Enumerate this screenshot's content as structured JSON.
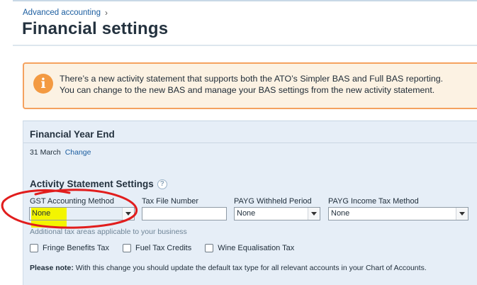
{
  "breadcrumb": {
    "parent": "Advanced accounting",
    "separator": "›"
  },
  "page": {
    "title": "Financial settings"
  },
  "notice": {
    "icon": "info-icon",
    "line1": "There’s a new activity statement that supports both the ATO’s Simpler BAS and Full BAS reporting.",
    "line2": "You can change to the new BAS and manage your BAS settings from the new activity statement."
  },
  "financial_year_end": {
    "heading": "Financial Year End",
    "value": "31 March",
    "change_link": "Change"
  },
  "activity_statement": {
    "heading": "Activity Statement Settings",
    "help_icon": "question-mark-icon",
    "fields": {
      "gst_method": {
        "label": "GST Accounting Method",
        "value": "None"
      },
      "tfn": {
        "label": "Tax File Number",
        "value": ""
      },
      "payg_withheld": {
        "label": "PAYG Withheld Period",
        "value": "None"
      },
      "payg_income": {
        "label": "PAYG Income Tax Method",
        "value": "None"
      }
    },
    "hint": "Additional tax areas applicable to your business",
    "checkboxes": {
      "fbt": {
        "label": "Fringe Benefits Tax",
        "checked": false
      },
      "fuel": {
        "label": "Fuel Tax Credits",
        "checked": false
      },
      "wet": {
        "label": "Wine Equalisation Tax",
        "checked": false
      }
    },
    "note": {
      "prefix": "Please note:",
      "text": " With this change you should update the default tax type for all relevant accounts in your Chart of Accounts."
    }
  },
  "colors": {
    "link": "#1c5ea0",
    "notice_border": "#f5a25f",
    "notice_bg": "#fcf2e3",
    "panel_bg": "#e6eef7",
    "highlight": "#f3f500",
    "annotation_circle": "#e11d1d"
  }
}
